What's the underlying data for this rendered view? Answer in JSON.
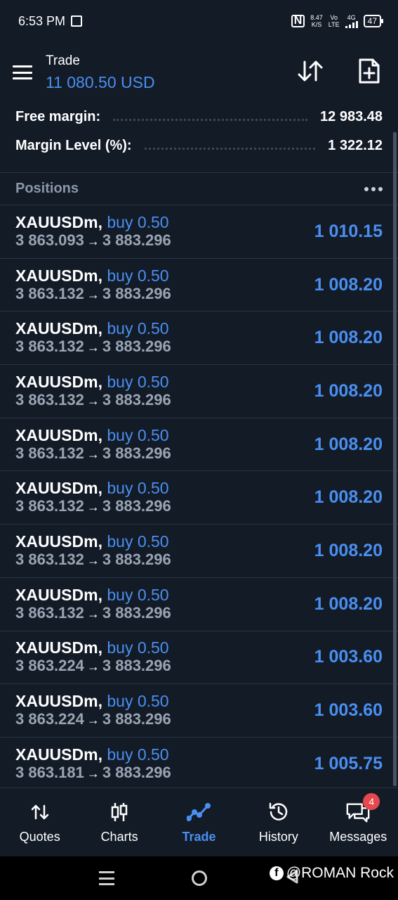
{
  "status_bar": {
    "time": "6:53 PM",
    "speed_value": "8.47",
    "speed_unit": "K/S",
    "net_top": "Vo",
    "net_bottom": "LTE",
    "network": "4G",
    "battery": "47"
  },
  "header": {
    "title": "Trade",
    "balance": "11 080.50 USD"
  },
  "summary": {
    "free_margin_label": "Free margin:",
    "free_margin_value": "12 983.48",
    "margin_level_label": "Margin Level (%):",
    "margin_level_value": "1 322.12"
  },
  "positions": {
    "heading": "Positions",
    "rows": [
      {
        "symbol": "XAUUSDm,",
        "side": "buy 0.50",
        "open": "3 863.093",
        "arrow": "→",
        "current": "3 883.296",
        "profit": "1 010.15"
      },
      {
        "symbol": "XAUUSDm,",
        "side": "buy 0.50",
        "open": "3 863.132",
        "arrow": "→",
        "current": "3 883.296",
        "profit": "1 008.20"
      },
      {
        "symbol": "XAUUSDm,",
        "side": "buy 0.50",
        "open": "3 863.132",
        "arrow": "→",
        "current": "3 883.296",
        "profit": "1 008.20"
      },
      {
        "symbol": "XAUUSDm,",
        "side": "buy 0.50",
        "open": "3 863.132",
        "arrow": "→",
        "current": "3 883.296",
        "profit": "1 008.20"
      },
      {
        "symbol": "XAUUSDm,",
        "side": "buy 0.50",
        "open": "3 863.132",
        "arrow": "→",
        "current": "3 883.296",
        "profit": "1 008.20"
      },
      {
        "symbol": "XAUUSDm,",
        "side": "buy 0.50",
        "open": "3 863.132",
        "arrow": "→",
        "current": "3 883.296",
        "profit": "1 008.20"
      },
      {
        "symbol": "XAUUSDm,",
        "side": "buy 0.50",
        "open": "3 863.132",
        "arrow": "→",
        "current": "3 883.296",
        "profit": "1 008.20"
      },
      {
        "symbol": "XAUUSDm,",
        "side": "buy 0.50",
        "open": "3 863.132",
        "arrow": "→",
        "current": "3 883.296",
        "profit": "1 008.20"
      },
      {
        "symbol": "XAUUSDm,",
        "side": "buy 0.50",
        "open": "3 863.224",
        "arrow": "→",
        "current": "3 883.296",
        "profit": "1 003.60"
      },
      {
        "symbol": "XAUUSDm,",
        "side": "buy 0.50",
        "open": "3 863.224",
        "arrow": "→",
        "current": "3 883.296",
        "profit": "1 003.60"
      },
      {
        "symbol": "XAUUSDm,",
        "side": "buy 0.50",
        "open": "3 863.181",
        "arrow": "→",
        "current": "3 883.296",
        "profit": "1 005.75"
      }
    ]
  },
  "tabs": [
    {
      "label": "Quotes",
      "icon": "quotes-icon"
    },
    {
      "label": "Charts",
      "icon": "charts-icon"
    },
    {
      "label": "Trade",
      "icon": "trade-icon",
      "active": true
    },
    {
      "label": "History",
      "icon": "history-icon"
    },
    {
      "label": "Messages",
      "icon": "messages-icon",
      "badge": "4"
    }
  ],
  "watermark": {
    "fb_letter": "f",
    "text": "@ROMAN Rock"
  },
  "colors": {
    "background": "#131b27",
    "accent": "#4a8ff0",
    "divider": "#2b3443",
    "muted_text": "#9aa4b3",
    "badge": "#e5484d"
  }
}
